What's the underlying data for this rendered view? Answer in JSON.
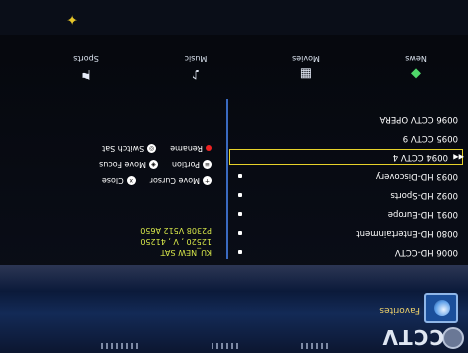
{
  "favorites": {
    "title": "Favorites"
  },
  "brand": {
    "text": "CCTV"
  },
  "channels": [
    {
      "number": "0006",
      "name": "HD-CCTV",
      "has_dot": true,
      "selected": false
    },
    {
      "number": "0080",
      "name": "HD-Entertainment",
      "has_dot": true,
      "selected": false
    },
    {
      "number": "0091",
      "name": "HD-Europe",
      "has_dot": true,
      "selected": false
    },
    {
      "number": "0092",
      "name": "HD-Sports",
      "has_dot": true,
      "selected": false
    },
    {
      "number": "0093",
      "name": "HD-Discovery",
      "has_dot": true,
      "selected": false
    },
    {
      "number": "0094",
      "name": "CCTV 4",
      "has_dot": false,
      "selected": true
    },
    {
      "number": "0095",
      "name": "CCTV 9",
      "has_dot": false,
      "selected": false
    },
    {
      "number": "0096",
      "name": "CCTV OPERA",
      "has_dot": false,
      "selected": false
    }
  ],
  "info": {
    "satellite": "KU_NEW SAT",
    "transponder": "12520 , V , 41250",
    "pids": "P2308 V512 A650"
  },
  "help": {
    "move_cursor": "Move Cursor",
    "close": "Close",
    "move_focus": "Move Focus",
    "portion": "Portion",
    "switch_sat": "Switch Sat",
    "rename": "Rename"
  },
  "tabs": [
    {
      "label": "News",
      "icon": "news-icon"
    },
    {
      "label": "Movies",
      "icon": "movies-icon"
    },
    {
      "label": "Music",
      "icon": "music-icon"
    },
    {
      "label": "Sports",
      "icon": "sports-icon"
    }
  ],
  "colors": {
    "selection": "#e6d12a",
    "info_text": "#d8e84a",
    "divider": "#3a6ac0",
    "favorites_title": "#f1d36a"
  }
}
